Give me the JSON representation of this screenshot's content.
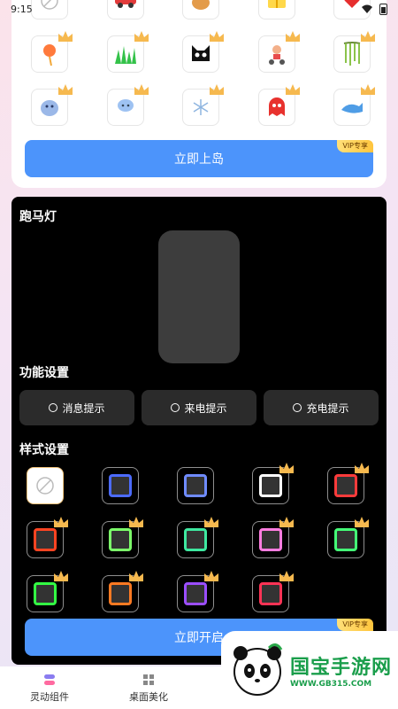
{
  "status_bar": {
    "time": "9:15",
    "wifi_icon": "wifi-icon",
    "battery_icon": "battery-icon"
  },
  "top_card": {
    "icon_rows": [
      [
        "no-symbol-icon",
        "car-icon",
        "dog-icon",
        "gift-icon",
        "heart-icon"
      ],
      [
        "lantern-icon",
        "grass-icon",
        "black-cat-icon",
        "scooter-icon",
        "willow-icon"
      ],
      [
        "sloth-icon",
        "jellyfish-icon",
        "snowflake-icon",
        "ghost-icon",
        "whale-icon"
      ]
    ],
    "vip_badge": "VIP专享",
    "primary_button": "立即上岛"
  },
  "black_panel": {
    "marquee_title": "跑马灯",
    "function_title": "功能设置",
    "function_options": [
      "消息提示",
      "来电提示",
      "充电提示"
    ],
    "style_title": "样式设置",
    "vip_badge": "VIP专享",
    "primary_button": "立即开启",
    "style_colors": [
      [
        "none",
        "#4c6bff",
        "#6f8bff",
        "#ffffff",
        "#ff3b3b"
      ],
      [
        "#ff4422",
        "#7cff6a",
        "#3ee8a0",
        "#ff7de0",
        "#44ff77"
      ],
      [
        "#33ff44",
        "#ff7a22",
        "#9b4dff",
        "#ff3355"
      ]
    ]
  },
  "bottom_nav": {
    "items": [
      {
        "label": "灵动组件",
        "icon": "widget-icon"
      },
      {
        "label": "桌面美化",
        "icon": "grid-icon"
      }
    ]
  },
  "watermark": {
    "brand": "国宝手游网",
    "url": "WWW.GB315.COM"
  }
}
